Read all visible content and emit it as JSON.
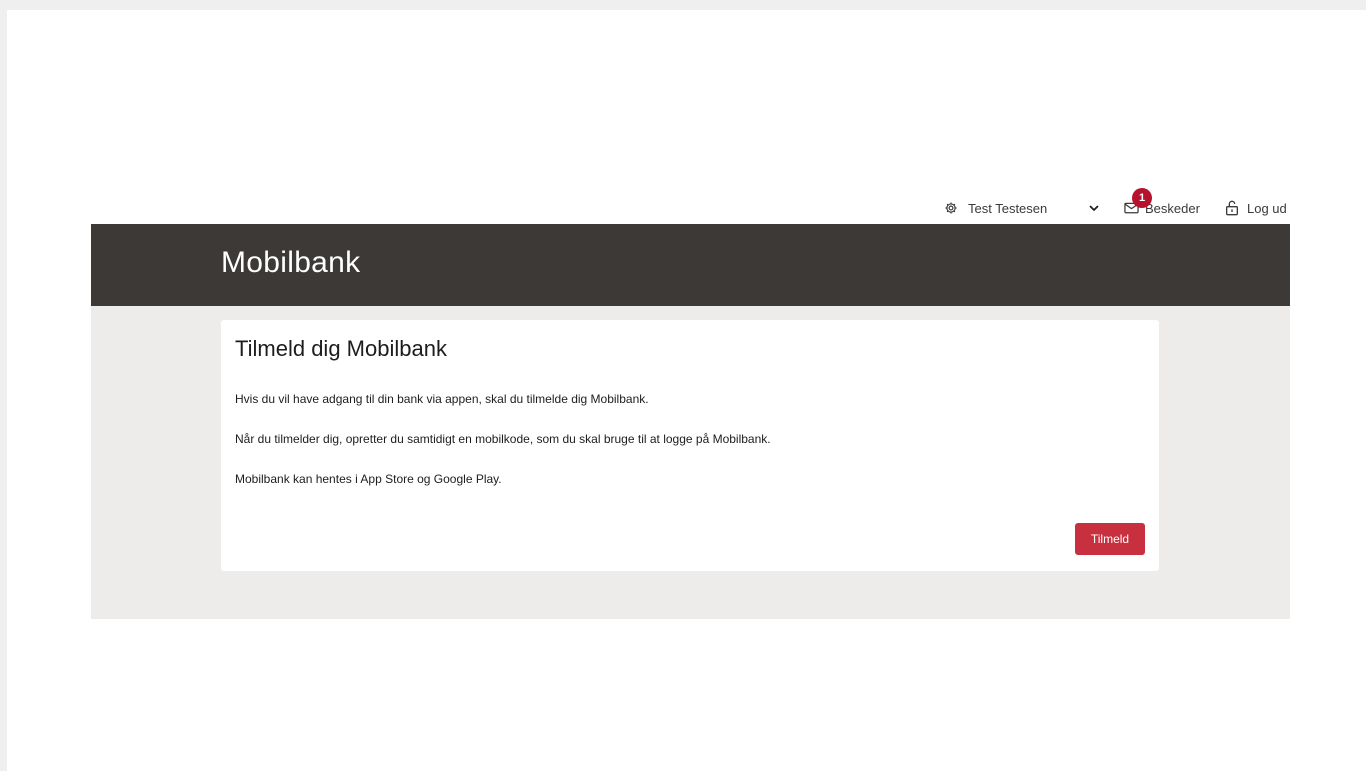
{
  "topnav": {
    "user_name": "Test Testesen",
    "messages_label": "Beskeder",
    "messages_badge": "1",
    "logout_label": "Log ud"
  },
  "hero": {
    "title": "Mobilbank"
  },
  "card": {
    "title": "Tilmeld dig Mobilbank",
    "paragraphs": [
      "Hvis du vil have adgang til din bank via appen, skal du tilmelde dig Mobilbank.",
      "Når du tilmelder dig, opretter du samtidigt en mobilkode, som du skal bruge til at logge på Mobilbank.",
      "Mobilbank kan hentes i App Store og Google Play."
    ],
    "button_label": "Tilmeld"
  },
  "colors": {
    "header_bg": "#3d3936",
    "content_bg": "#edecea",
    "accent": "#c8303f",
    "badge": "#b5122d"
  },
  "icons": {
    "settings": "gear-icon",
    "dropdown": "chevron-down-icon",
    "messages": "envelope-icon",
    "logout": "lock-icon"
  }
}
